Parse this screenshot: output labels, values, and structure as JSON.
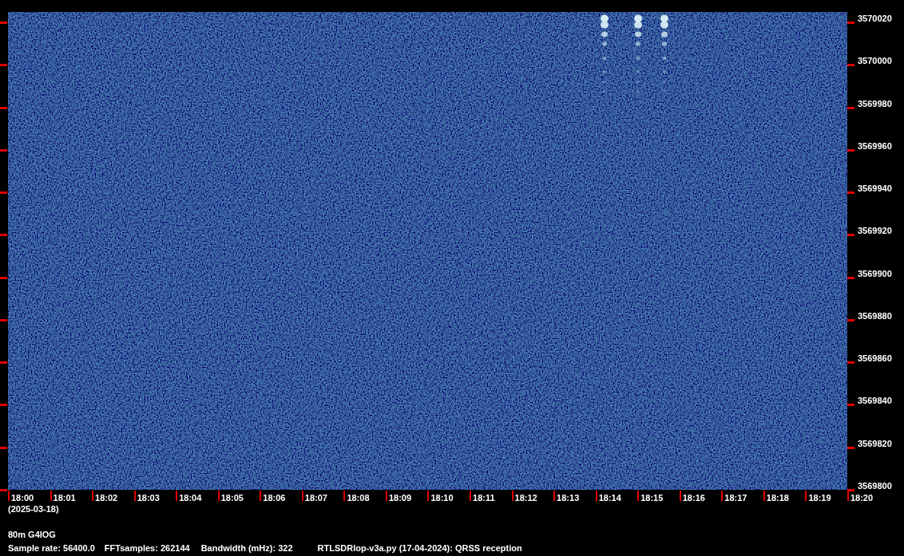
{
  "spectrogram": {
    "frequency_labels": [
      "3570020",
      "3570000",
      "3569980",
      "3569960",
      "3569940",
      "3569920",
      "3569900",
      "3569880",
      "3569860",
      "3569840",
      "3569820",
      "3569800"
    ],
    "time_labels": [
      "18:00",
      "18:01",
      "18:02",
      "18:03",
      "18:04",
      "18:05",
      "18:06",
      "18:07",
      "18:08",
      "18:09",
      "18:10",
      "18:11",
      "18:12",
      "18:13",
      "18:14",
      "18:15",
      "18:16",
      "18:17",
      "18:18",
      "18:19",
      "18:20"
    ],
    "date": "(2025-03-18)"
  },
  "footer": {
    "station": "80m G4IOG",
    "sample_rate": "Sample rate: 56400.0",
    "fft_samples": "FFTsamples: 262144",
    "bandwidth": "Bandwidth (mHz): 322",
    "program": "RTLSDRlop-v3a.py (17-04-2024): QRSS reception"
  }
}
